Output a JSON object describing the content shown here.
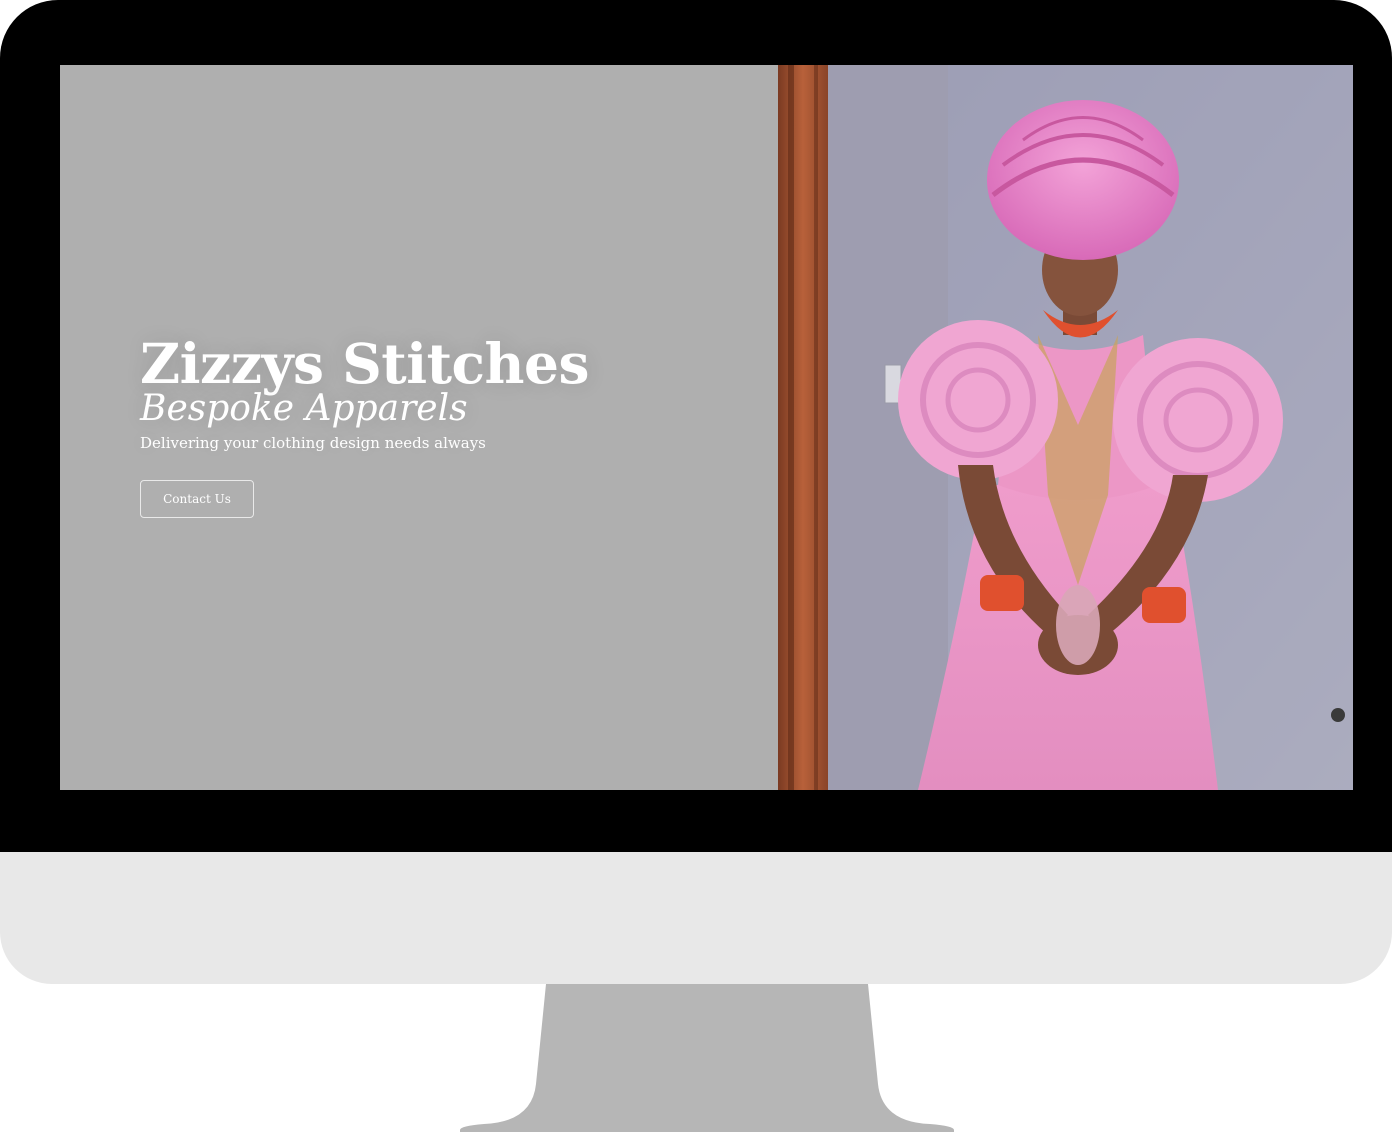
{
  "hero": {
    "title": "Zizzys Stitches",
    "subtitle": "Bespoke Apparels",
    "tagline": "Delivering your clothing design needs always",
    "contact_button": "Contact Us"
  },
  "colors": {
    "bezel": "#000000",
    "chin": "#e8e8e8",
    "stand": "#b6b6b6",
    "hero_background": "#afafaf",
    "hero_text": "#ffffff"
  }
}
